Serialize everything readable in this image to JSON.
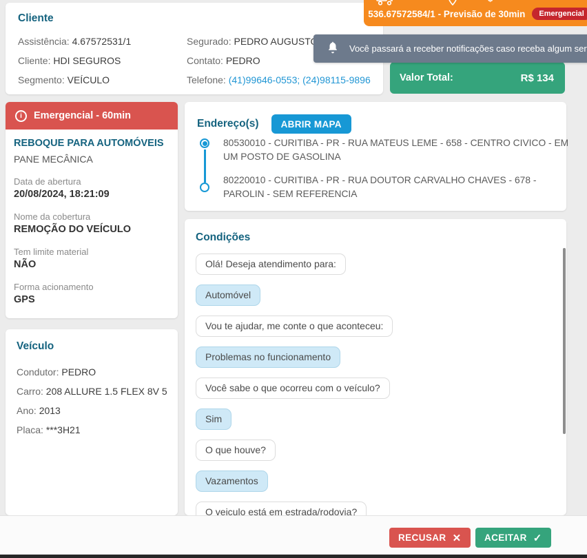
{
  "client_card": {
    "title": "Cliente",
    "fields_left": [
      {
        "label": "Assistência:",
        "value": "4.67572531/1"
      },
      {
        "label": "Cliente:",
        "value": "HDI SEGUROS"
      },
      {
        "label": "Segmento:",
        "value": "VEÍCULO"
      }
    ],
    "fields_right": [
      {
        "label": "Segurado:",
        "value": "PEDRO AUGUSTO"
      },
      {
        "label": "Contato:",
        "value": "PEDRO"
      },
      {
        "label": "Telefone:",
        "value": "(41)99646-0553; (24)98115-9896"
      }
    ]
  },
  "offer_popup": {
    "header": "536.67572584/1 - Previsão de 30min",
    "badge": "Emergencial",
    "total_label": "Valor Total:",
    "total_value": "R$ 134",
    "dollar_icon": "$"
  },
  "toast": {
    "message": "Você passará a receber notificações caso receba algum serv"
  },
  "service_card": {
    "banner": "Emergencial - 60min",
    "info_glyph": "i",
    "service_name": "REBOQUE PARA AUTOMÓVEIS",
    "problem": "PANE MECÂNICA",
    "details": [
      {
        "label": "Data de abertura",
        "value": "20/08/2024, 18:21:09"
      },
      {
        "label": "Nome da cobertura",
        "value": "REMOÇÃO DO VEÍCULO"
      },
      {
        "label": "Tem limite material",
        "value": "NÃO"
      },
      {
        "label": "Forma acionamento",
        "value": "GPS"
      }
    ]
  },
  "vehicle_card": {
    "title": "Veículo",
    "fields": [
      {
        "label": "Condutor:",
        "value": "PEDRO"
      },
      {
        "label": "Carro:",
        "value": "208 ALLURE 1.5 FLEX 8V 5"
      },
      {
        "label": "Ano:",
        "value": "2013"
      },
      {
        "label": "Placa:",
        "value": "***3H21"
      }
    ]
  },
  "addresses_card": {
    "title": "Endereço(s)",
    "map_button": "ABRIR MAPA",
    "addresses": [
      "80530010 - CURITIBA - PR - RUA MATEUS LEME - 658 - CENTRO CIVICO - EM UM POSTO DE GASOLINA",
      "80220010 - CURITIBA - PR - RUA DOUTOR CARVALHO CHAVES - 678 - PAROLIN - SEM REFERENCIA"
    ]
  },
  "conditions_card": {
    "title": "Condições",
    "messages": [
      {
        "from": "bot",
        "text": "Olá! Deseja atendimento para:"
      },
      {
        "from": "user",
        "text": "Automóvel"
      },
      {
        "from": "bot",
        "text": "Vou te ajudar, me conte o que aconteceu:"
      },
      {
        "from": "user",
        "text": "Problemas no funcionamento"
      },
      {
        "from": "bot",
        "text": "Você sabe o que ocorreu com o veículo?"
      },
      {
        "from": "user",
        "text": "Sim"
      },
      {
        "from": "bot",
        "text": "O que houve?"
      },
      {
        "from": "user",
        "text": "Vazamentos"
      },
      {
        "from": "bot",
        "text": "O veiculo está em estrada/rodovia?"
      }
    ]
  },
  "footer": {
    "reject": "RECUSAR",
    "reject_icon": "✕",
    "accept": "ACEITAR",
    "accept_icon": "✓"
  },
  "colors": {
    "accent_blue": "#1798d5",
    "heading_blue": "#15637f",
    "orange": "#f68a1e",
    "red": "#d9544f",
    "badge_red": "#c5262d",
    "green": "#35a47c",
    "toast_grey": "#6d7a8c",
    "link_blue": "#2196d4"
  }
}
